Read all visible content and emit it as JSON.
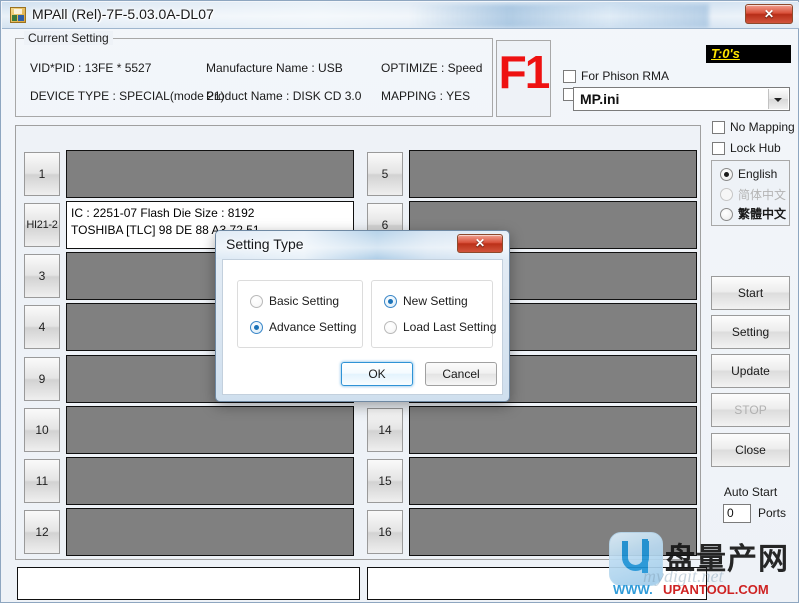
{
  "window": {
    "title": "MPAll (Rel)-7F-5.03.0A-DL07",
    "close_label": "✕",
    "icon": "app-icon"
  },
  "current_setting": {
    "legend": "Current Setting",
    "vid_pid": "VID*PID : 13FE * 5527",
    "manufacture_name": "Manufacture Name : USB",
    "optimize": "OPTIMIZE : Speed",
    "device_type": "DEVICE TYPE : SPECIAL(mode 21)",
    "product_name": "Product Name : DISK CD 3.0",
    "mapping": "MAPPING : YES"
  },
  "f1_badge": "F1",
  "counter_badge": "T:0's",
  "top_right": {
    "for_phison_rma": "For Phison RMA",
    "ini_file": "MP.ini"
  },
  "sidebar": {
    "no_mapping": "No Mapping",
    "lock_hub": "Lock Hub",
    "languages": [
      {
        "label": "English",
        "checked": true,
        "disabled": false
      },
      {
        "label": "简体中文",
        "checked": false,
        "disabled": true
      },
      {
        "label": "繁體中文",
        "checked": false,
        "disabled": false
      }
    ],
    "buttons": [
      {
        "label": "Start",
        "disabled": false
      },
      {
        "label": "Setting",
        "disabled": false
      },
      {
        "label": "Update",
        "disabled": false
      },
      {
        "label": "STOP",
        "disabled": true
      },
      {
        "label": "Close",
        "disabled": false
      }
    ],
    "auto_start_label": "Auto Start",
    "auto_start_value": "0",
    "auto_start_units": "Ports"
  },
  "ports": {
    "left": [
      {
        "num": "1",
        "active": false,
        "line1": "",
        "line2": ""
      },
      {
        "num": "HI21-2",
        "active": true,
        "line1": "IC : 2251-07  Flash Die Size : 8192",
        "line2": "TOSHIBA [TLC] 98 DE 88 A3 72 51"
      },
      {
        "num": "3",
        "active": false,
        "line1": "",
        "line2": ""
      },
      {
        "num": "4",
        "active": false,
        "line1": "",
        "line2": ""
      },
      {
        "num": "9",
        "active": false,
        "line1": "",
        "line2": ""
      },
      {
        "num": "10",
        "active": false,
        "line1": "",
        "line2": ""
      },
      {
        "num": "11",
        "active": false,
        "line1": "",
        "line2": ""
      },
      {
        "num": "12",
        "active": false,
        "line1": "",
        "line2": ""
      }
    ],
    "right": [
      {
        "num": "5",
        "active": false,
        "line1": "",
        "line2": ""
      },
      {
        "num": "6",
        "active": false,
        "line1": "",
        "line2": ""
      },
      {
        "num": "",
        "active": false,
        "line1": "",
        "line2": ""
      },
      {
        "num": "",
        "active": false,
        "line1": "",
        "line2": ""
      },
      {
        "num": "",
        "active": false,
        "line1": "",
        "line2": ""
      },
      {
        "num": "14",
        "active": false,
        "line1": "",
        "line2": ""
      },
      {
        "num": "15",
        "active": false,
        "line1": "",
        "line2": ""
      },
      {
        "num": "16",
        "active": false,
        "line1": "",
        "line2": ""
      }
    ]
  },
  "dialog": {
    "title": "Setting Type",
    "close_label": "✕",
    "mode_options": [
      {
        "label": "Basic Setting",
        "checked": false
      },
      {
        "label": "Advance Setting",
        "checked": true
      }
    ],
    "source_options": [
      {
        "label": "New Setting",
        "checked": true
      },
      {
        "label": "Load Last Setting",
        "checked": false
      }
    ],
    "ok_label": "OK",
    "cancel_label": "Cancel"
  },
  "watermark": {
    "chinese": "盘量产网",
    "www": "WWW.",
    "domain": "UPANTOOL.COM",
    "ghost": "mydigit.net"
  },
  "colors": {
    "accent_red": "#ee1111",
    "badge_bg": "#000000",
    "badge_fg": "#ffe400",
    "port_idle": "#808080",
    "dialog_ok_border": "#2f93d6",
    "watermark_blue": "#1e93d6",
    "watermark_red": "#cc1111"
  }
}
